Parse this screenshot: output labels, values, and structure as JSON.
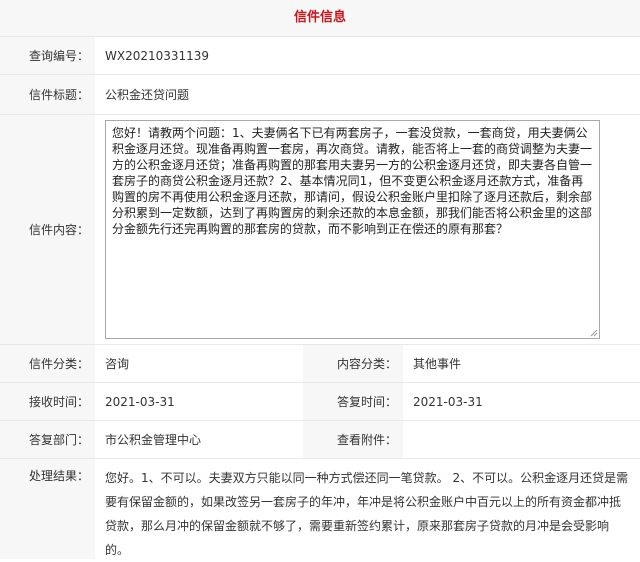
{
  "header": {
    "title": "信件信息"
  },
  "fields": {
    "query_no_label": "查询编号：",
    "query_no_value": "WX20210331139",
    "title_label": "信件标题：",
    "title_value": "公积金还贷问题",
    "content_label": "信件内容：",
    "content_value": "您好！请教两个问题：1、夫妻俩名下已有两套房子，一套没贷款，一套商贷，用夫妻俩公积金逐月还贷。现准备再购置一套房，再次商贷。请教，能否将上一套的商贷调整为夫妻一方的公积金逐月还贷；准备再购置的那套用夫妻另一方的公积金逐月还贷，即夫妻各自管一套房子的商贷公积金逐月还款？2、基本情况同1，但不变更公积金逐月还款方式，准备再购置的房不再使用公积金逐月还款，那请问，假设公积金账户里扣除了逐月还款后，剩余部分积累到一定数额，达到了再购置房的剩余还款的本息金额，那我们能否将公积金里的这部分金额先行还完再购置的那套房的贷款，而不影响到正在偿还的原有那套？",
    "category_label": "信件分类：",
    "category_value": "咨询",
    "content_category_label": "内容分类：",
    "content_category_value": "其他事件",
    "received_label": "接收时间：",
    "received_value": "2021-03-31",
    "reply_time_label": "答复时间：",
    "reply_time_value": "2021-03-31",
    "reply_dept_label": "答复部门：",
    "reply_dept_value": "市公积金管理中心",
    "attachment_label": "查看附件：",
    "attachment_value": "",
    "result_label": "处理结果：",
    "result_value": "您好。1、不可以。夫妻双方只能以同一种方式偿还同一笔贷款。 2、不可以。公积金逐月还贷是需要有保留金额的，如果改签另一套房子的年冲，年冲是将公积金账户中百元以上的所有资金都冲抵贷款，那么月冲的保留金额就不够了，需要重新签约累计，原来那套房子贷款的月冲是会受影响的。"
  },
  "colors": {
    "header_text": "#c8161d",
    "label_bg": "#f7f7f7",
    "border": "#e8e8e8"
  }
}
